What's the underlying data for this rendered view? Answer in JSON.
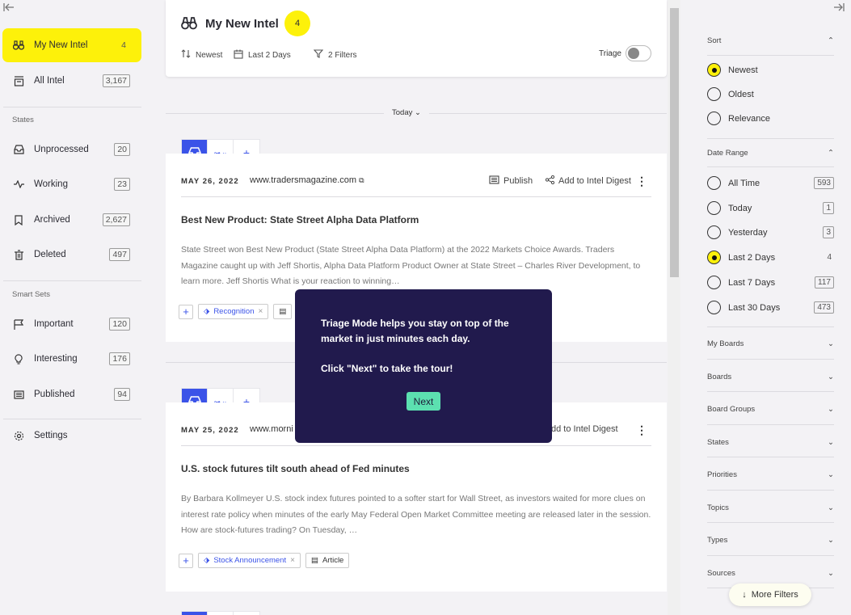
{
  "sidebar": {
    "items": [
      {
        "label": "My New Intel",
        "count": "4"
      },
      {
        "label": "All Intel",
        "count": "3,167"
      }
    ],
    "states_label": "States",
    "states": [
      {
        "label": "Unprocessed",
        "count": "20"
      },
      {
        "label": "Working",
        "count": "23"
      },
      {
        "label": "Archived",
        "count": "2,627"
      },
      {
        "label": "Deleted",
        "count": "497"
      }
    ],
    "smart_sets_label": "Smart Sets",
    "smart_sets": [
      {
        "label": "Important",
        "count": "120"
      },
      {
        "label": "Interesting",
        "count": "176"
      },
      {
        "label": "Published",
        "count": "94"
      }
    ],
    "settings_label": "Settings"
  },
  "header": {
    "title": "My New Intel",
    "badge": "4",
    "sort": "Newest",
    "range": "Last 2 Days",
    "filters": "2 Filters",
    "triage_label": "Triage"
  },
  "feed": {
    "group_label": "Today",
    "cards": [
      {
        "date": "MAY 26, 2022",
        "source": "www.tradersmagazine.com",
        "publish": "Publish",
        "digest": "Add to Intel Digest",
        "title": "Best New Product: State Street Alpha Data Platform",
        "body": "State Street won Best New Product (State Street Alpha Data Platform) at the  2022 Markets Choice Awards. Traders Magazine caught up with Jeff Shortis, Alpha Data Platform Product Owner at State Street – Charles River Development, to learn more. Jeff Shortis What is your reaction to winning…",
        "tag": "Recognition"
      },
      {
        "date": "MAY 25, 2022",
        "source": "www.morni",
        "digest": "dd to Intel Digest",
        "title": "U.S. stock futures tilt south ahead of Fed minutes",
        "body": "By Barbara Kollmeyer U.S. stock index futures pointed to a softer start for Wall Street, as investors waited for more clues on interest rate policy when minutes of the early May Federal Open Market Committee meeting are released later in the session. How are stock-futures trading? On Tuesday, …",
        "tag": "Stock Announcement",
        "type": "Article"
      }
    ]
  },
  "filters": {
    "sort_label": "Sort",
    "sort_options": [
      {
        "label": "Newest",
        "selected": true
      },
      {
        "label": "Oldest",
        "selected": false
      },
      {
        "label": "Relevance",
        "selected": false
      }
    ],
    "date_label": "Date Range",
    "date_options": [
      {
        "label": "All Time",
        "count": "593"
      },
      {
        "label": "Today",
        "count": "1"
      },
      {
        "label": "Yesterday",
        "count": "3"
      },
      {
        "label": "Last 2 Days",
        "count": "4"
      },
      {
        "label": "Last 7 Days",
        "count": "117"
      },
      {
        "label": "Last 30 Days",
        "count": "473"
      }
    ],
    "collapsed": [
      "My Boards",
      "Boards",
      "Board Groups",
      "States",
      "Priorities",
      "Topics",
      "Types",
      "Sources"
    ],
    "more_filters": "More Filters"
  },
  "tour": {
    "text": "Triage Mode helps you stay on top of the market in just minutes each day.",
    "text2": "Click \"Next\" to take the tour!",
    "next": "Next"
  },
  "colors": {
    "accent_yellow": "#fdf10a",
    "accent_blue": "#3b53e8",
    "tour_bg": "#211a4d",
    "next_btn": "#5ce0b0"
  }
}
